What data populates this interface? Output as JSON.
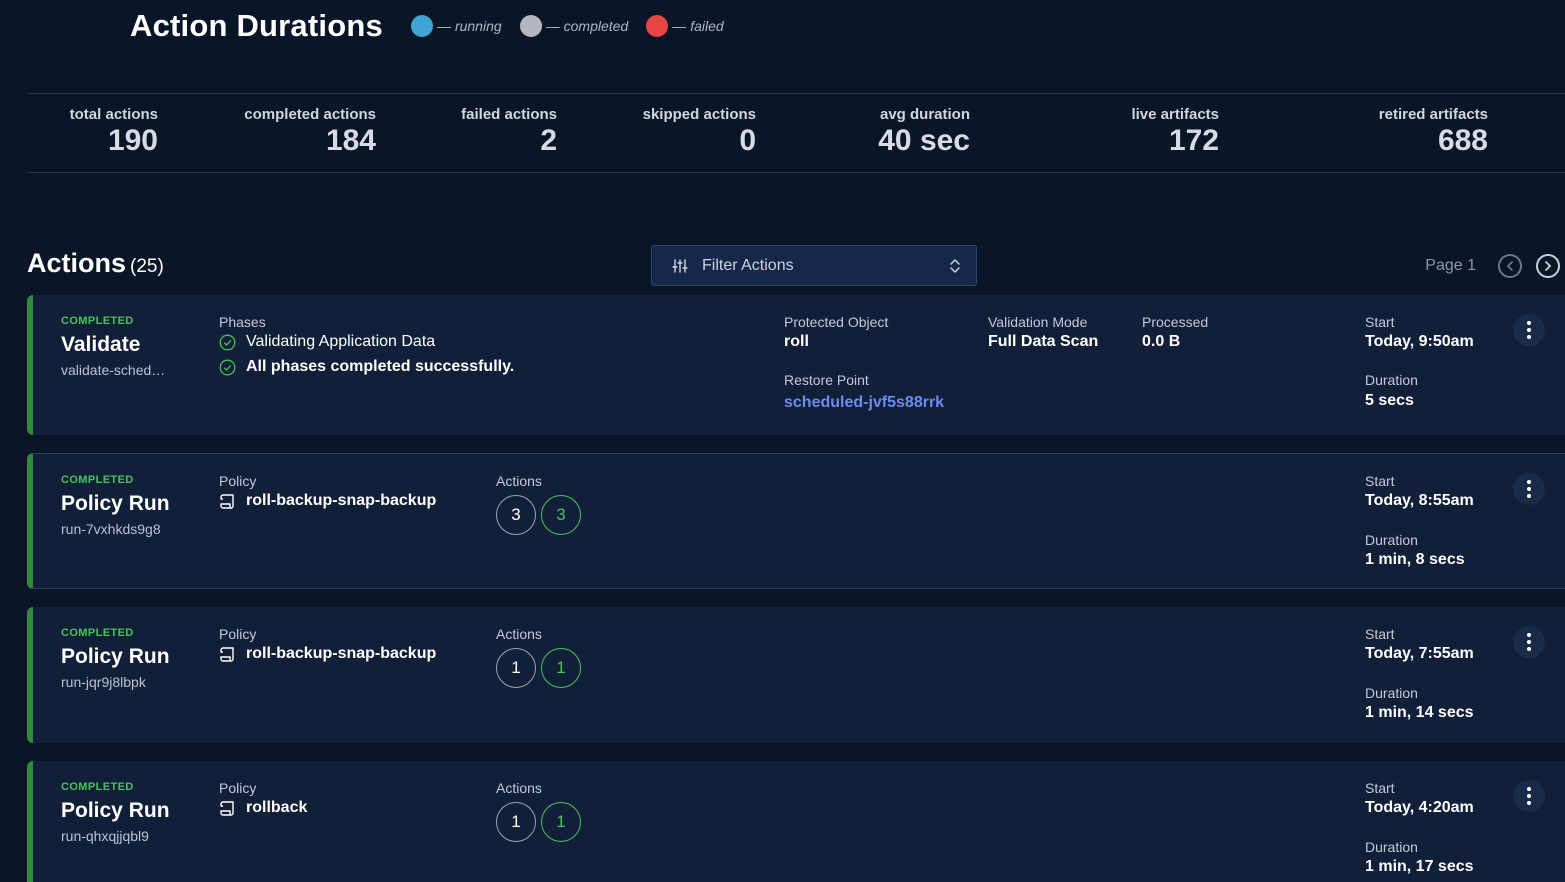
{
  "header": {
    "title": "Action Durations",
    "legend": [
      {
        "label": "running",
        "color": "#3fa6d4"
      },
      {
        "label": "completed",
        "color": "#b4b8be"
      },
      {
        "label": "failed",
        "color": "#e84545"
      }
    ]
  },
  "stats": [
    {
      "label": "total actions",
      "value": "190"
    },
    {
      "label": "completed actions",
      "value": "184"
    },
    {
      "label": "failed actions",
      "value": "2"
    },
    {
      "label": "skipped actions",
      "value": "0"
    },
    {
      "label": "avg duration",
      "value": "40 sec"
    },
    {
      "label": "live artifacts",
      "value": "172"
    },
    {
      "label": "retired artifacts",
      "value": "688"
    }
  ],
  "actions": {
    "title": "Actions",
    "count": "(25)",
    "filter_label": "Filter Actions",
    "page_label": "Page 1"
  },
  "cards": [
    {
      "status": "COMPLETED",
      "name": "Validate",
      "id": "validate-scheduled",
      "phases_label": "Phases",
      "phases": [
        "Validating Application Data",
        "All phases completed successfully."
      ],
      "protected_object_label": "Protected Object",
      "protected_object": "roll",
      "restore_point_label": "Restore Point",
      "restore_point": "scheduled-jvf5s88rrk",
      "validation_mode_label": "Validation Mode",
      "validation_mode": "Full Data Scan",
      "processed_label": "Processed",
      "processed": "0.0 B",
      "start_label": "Start",
      "start": "Today, 9:50am",
      "duration_label": "Duration",
      "duration": "5 secs"
    },
    {
      "status": "COMPLETED",
      "name": "Policy Run",
      "id": "run-7vxhkds9g8",
      "policy_label": "Policy",
      "policy": "roll-backup-snap-backup",
      "actions_label": "Actions",
      "actions_total": "3",
      "actions_done": "3",
      "start_label": "Start",
      "start": "Today, 8:55am",
      "duration_label": "Duration",
      "duration": "1 min, 8 secs"
    },
    {
      "status": "COMPLETED",
      "name": "Policy Run",
      "id": "run-jqr9j8lbpk",
      "policy_label": "Policy",
      "policy": "roll-backup-snap-backup",
      "actions_label": "Actions",
      "actions_total": "1",
      "actions_done": "1",
      "start_label": "Start",
      "start": "Today, 7:55am",
      "duration_label": "Duration",
      "duration": "1 min, 14 secs"
    },
    {
      "status": "COMPLETED",
      "name": "Policy Run",
      "id": "run-qhxqjjqbl9",
      "policy_label": "Policy",
      "policy": "rollback",
      "actions_label": "Actions",
      "actions_total": "1",
      "actions_done": "1",
      "start_label": "Start",
      "start": "Today, 4:20am",
      "duration_label": "Duration",
      "duration": "1 min, 17 secs"
    }
  ]
}
